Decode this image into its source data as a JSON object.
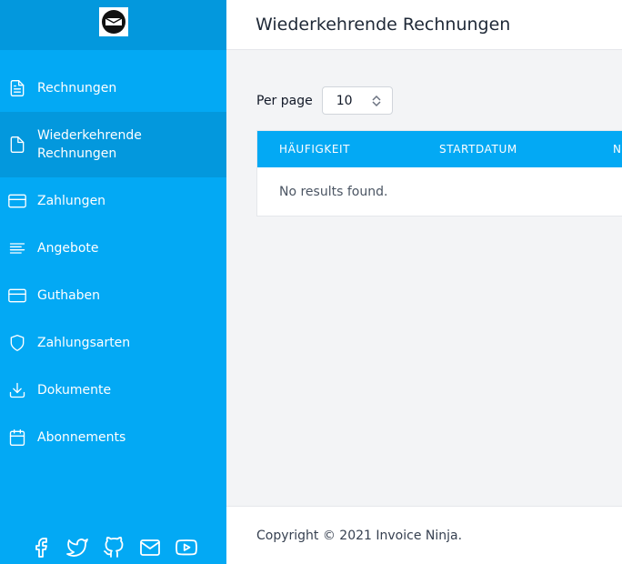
{
  "app": {
    "logo_icon": "invoice-ninja-logo"
  },
  "sidebar": {
    "items": [
      {
        "label": "Rechnungen",
        "icon": "file-text-icon",
        "active": false
      },
      {
        "label": "Wiederkehrende Rechnungen",
        "icon": "file-icon",
        "active": true
      },
      {
        "label": "Zahlungen",
        "icon": "credit-card-icon",
        "active": false
      },
      {
        "label": "Angebote",
        "icon": "align-left-icon",
        "active": false
      },
      {
        "label": "Guthaben",
        "icon": "credit-card-icon",
        "active": false
      },
      {
        "label": "Zahlungsarten",
        "icon": "shield-icon",
        "active": false
      },
      {
        "label": "Dokumente",
        "icon": "download-icon",
        "active": false
      },
      {
        "label": "Abonnements",
        "icon": "calendar-icon",
        "active": false
      }
    ],
    "socials": [
      "facebook-icon",
      "twitter-icon",
      "github-icon",
      "mail-icon",
      "youtube-icon"
    ]
  },
  "header": {
    "title": "Wiederkehrende Rechnungen"
  },
  "main": {
    "per_page_label": "Per page",
    "per_page_value": "10",
    "table": {
      "columns": [
        "HÄUFIGKEIT",
        "STARTDATUM",
        "N"
      ],
      "empty_text": "No results found."
    }
  },
  "footer": {
    "text": "Copyright © 2021 Invoice Ninja."
  },
  "colors": {
    "accent": "#03a9f4",
    "accent_dark": "#0398dd"
  }
}
